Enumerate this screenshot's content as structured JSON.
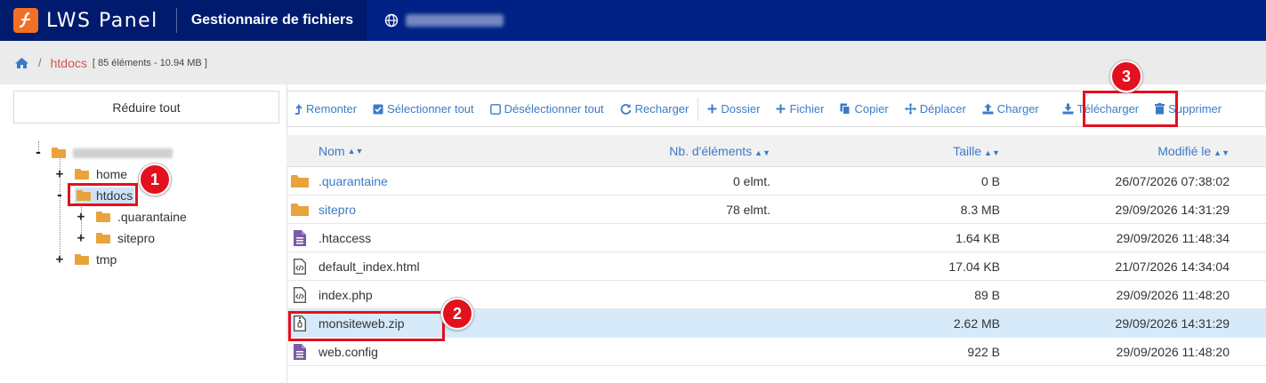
{
  "header": {
    "brand": "LWS Panel",
    "title": "Gestionnaire de fichiers",
    "domain_blurred": ""
  },
  "breadcrumb": {
    "current": "htdocs",
    "meta": "[ 85 éléments - 10.94 MB ]"
  },
  "tree": {
    "collapse_label": "Réduire tout",
    "items": [
      {
        "label": "home"
      },
      {
        "label": "htdocs"
      },
      {
        "label": ".quarantaine"
      },
      {
        "label": "sitepro"
      },
      {
        "label": "tmp"
      }
    ]
  },
  "toolbar": {
    "up": "Remonter",
    "select_all": "Sélectionner tout",
    "deselect_all": "Désélectionner tout",
    "reload": "Recharger",
    "folder": "Dossier",
    "file": "Fichier",
    "copy": "Copier",
    "move": "Déplacer",
    "upload": "Charger",
    "download": "Télécharger",
    "delete": "Supprimer"
  },
  "grid": {
    "headers": {
      "name": "Nom",
      "count": "Nb. d'éléments",
      "size": "Taille",
      "modified": "Modifié le"
    },
    "rows": [
      {
        "name": ".quarantaine",
        "count": "0 elmt.",
        "size": "0 B",
        "modified": "26/07/2026 07:38:02",
        "icon": "folder-icon"
      },
      {
        "name": "sitepro",
        "count": "78 elmt.",
        "size": "8.3 MB",
        "modified": "29/09/2026 14:31:29",
        "icon": "folder-icon"
      },
      {
        "name": ".htaccess",
        "count": "",
        "size": "1.64 KB",
        "modified": "29/09/2026 11:48:34",
        "icon": "text-file-icon"
      },
      {
        "name": "default_index.html",
        "count": "",
        "size": "17.04 KB",
        "modified": "21/07/2026 14:34:04",
        "icon": "code-file-icon"
      },
      {
        "name": "index.php",
        "count": "",
        "size": "89 B",
        "modified": "29/09/2026 11:48:20",
        "icon": "code-file-icon"
      },
      {
        "name": "monsiteweb.zip",
        "count": "",
        "size": "2.62 MB",
        "modified": "29/09/2026 14:31:29",
        "icon": "zip-file-icon"
      },
      {
        "name": "web.config",
        "count": "",
        "size": "922 B",
        "modified": "29/09/2026 11:48:20",
        "icon": "text-file-icon"
      }
    ]
  },
  "annotations": {
    "step1": "1",
    "step2": "2",
    "step3": "3",
    "color": "#e3101e"
  },
  "colors": {
    "topbar": "#002185",
    "accent_link": "#3a7bc8",
    "breadcrumb_link": "#d9534f",
    "folder": "#e8a33d",
    "selected_row": "#d6eaf9"
  }
}
